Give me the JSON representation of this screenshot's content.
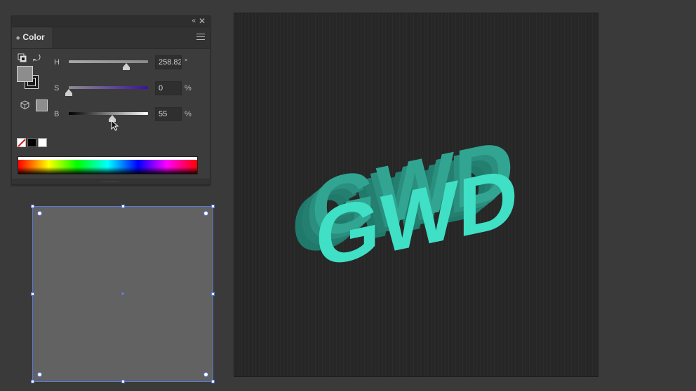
{
  "panel": {
    "collapse_icon": "«",
    "close_icon": "✕",
    "tab_label": "Color",
    "sliders": [
      {
        "label": "H",
        "value": "258.82",
        "unit": "°",
        "position": 0.72
      },
      {
        "label": "S",
        "value": "0",
        "unit": "%",
        "position": 0.0
      },
      {
        "label": "B",
        "value": "55",
        "unit": "%",
        "position": 0.55
      }
    ]
  },
  "artboard": {
    "artwork_text": "GWD",
    "face_color": "#3fe0c5",
    "extrusion_color": "#2a9d89"
  },
  "colors": {
    "current_fill": "#8d8d8d",
    "selection": "#5b7ad6",
    "shape_fill": "#626262"
  }
}
